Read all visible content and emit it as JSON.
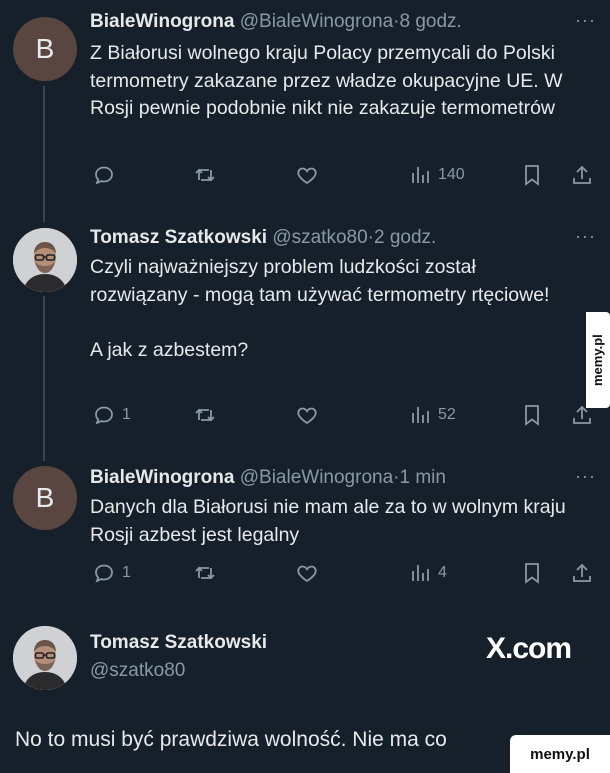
{
  "tweets": [
    {
      "avatar_letter": "B",
      "name": "BialeWinogrona",
      "handle": "@BialeWinogrona",
      "separator": "·",
      "time": "8 godz.",
      "text": "Z Białorusi wolnego kraju Polacy przemycali do Polski termometry zakazane przez władze okupacyjne UE. W Rosji pewnie podobnie nikt nie zakazuje termometrów",
      "reply_count": "",
      "view_count": "140"
    },
    {
      "name": "Tomasz Szatkowski",
      "handle": "@szatko80",
      "separator": "·",
      "time": "2 godz.",
      "text": "Czyli najważniejszy problem ludzkości został rozwiązany - mogą tam używać termometry rtęciowe!\n\nA jak z azbestem?",
      "reply_count": "1",
      "view_count": "52"
    },
    {
      "avatar_letter": "B",
      "name": "BialeWinogrona",
      "handle": "@BialeWinogrona",
      "separator": "·",
      "time": "1 min",
      "text": "Danych dla Białorusi nie mam ale za to w wolnym kraju Rosji azbest jest legalny",
      "reply_count": "1",
      "view_count": "4"
    }
  ],
  "card": {
    "name": "Tomasz Szatkowski",
    "handle": "@szatko80",
    "brand": "X.com",
    "text": "No to musi być prawdziwa wolność. Nie ma co"
  },
  "more_label": "···",
  "watermarks": {
    "side": "memy.pl",
    "bottom": "memy.pl"
  }
}
